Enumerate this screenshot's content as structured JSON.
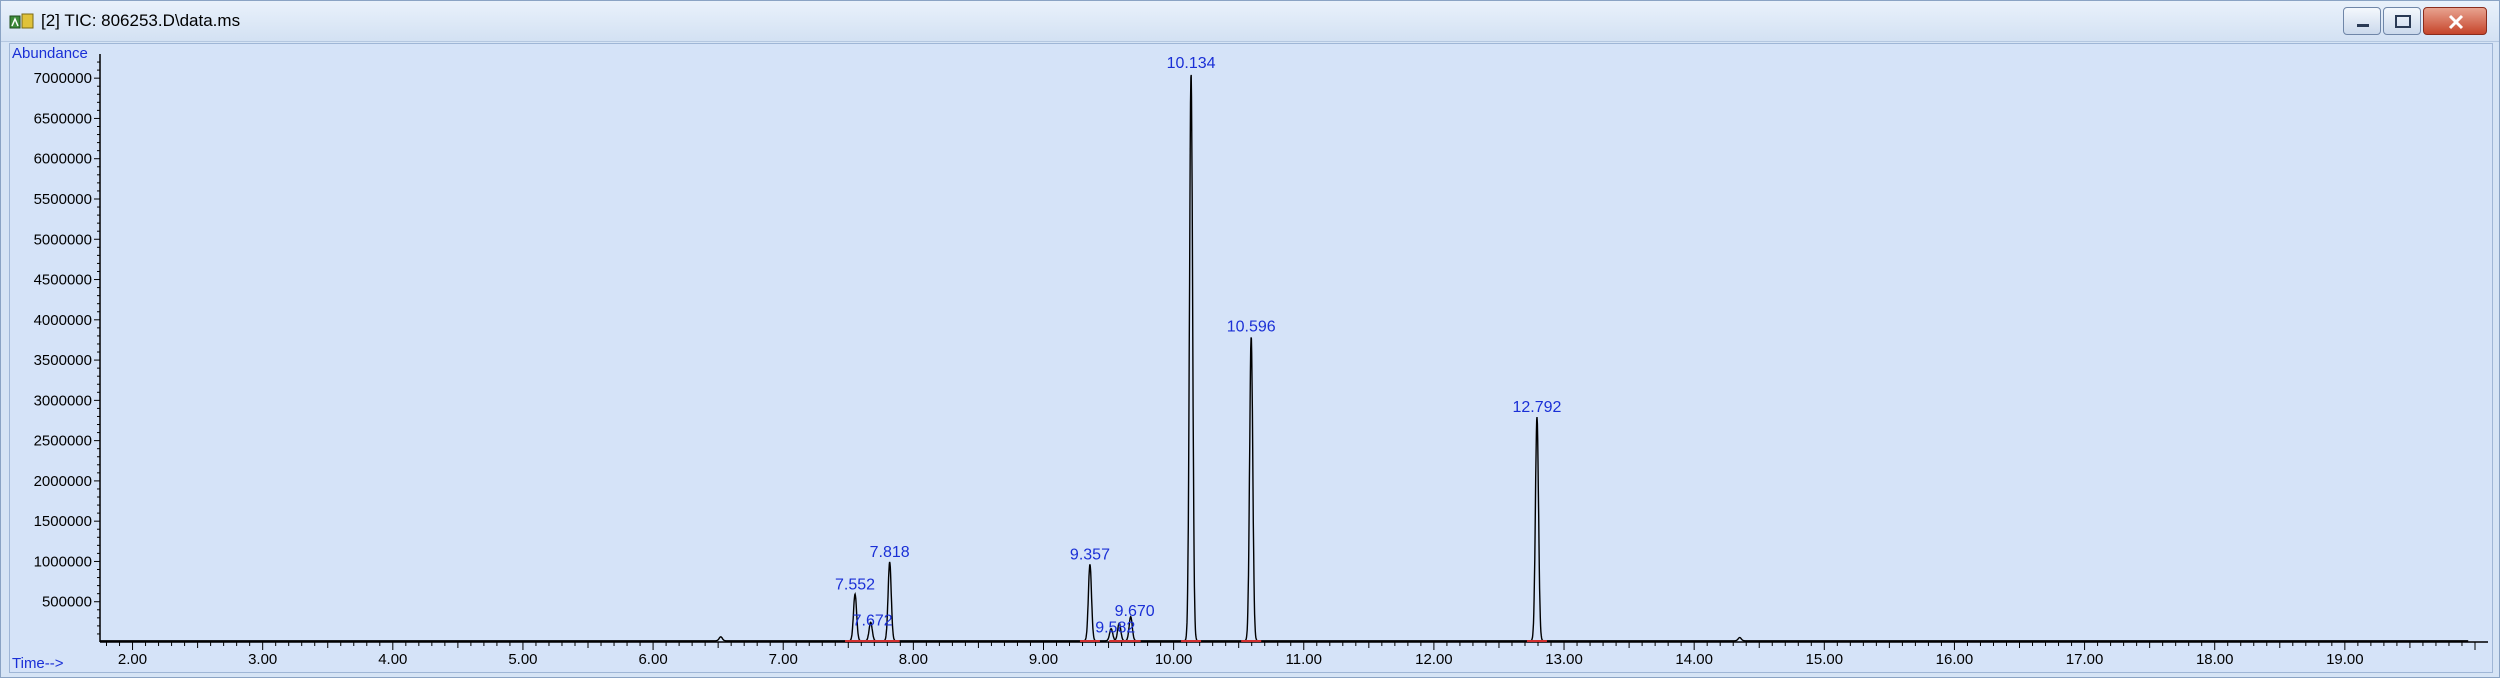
{
  "window": {
    "title": "[2] TIC: 806253.D\\data.ms",
    "icons": {
      "app": "chemstation-app-icon",
      "minimize": "minimize-icon",
      "maximize": "maximize-icon",
      "close": "close-icon"
    }
  },
  "colors": {
    "background": "#d5e3f8",
    "trace": "#000000",
    "labels": "#1a2fd6",
    "baseline_markers": "#d23030"
  },
  "chart_data": {
    "type": "line",
    "title": "",
    "xlabel": "Time-->",
    "ylabel": "Abundance",
    "xlim": [
      1.75,
      20.1
    ],
    "ylim": [
      0,
      7300000
    ],
    "x_ticks": [
      "2.00",
      "3.00",
      "4.00",
      "5.00",
      "6.00",
      "7.00",
      "8.00",
      "9.00",
      "10.00",
      "11.00",
      "12.00",
      "13.00",
      "14.00",
      "15.00",
      "16.00",
      "17.00",
      "18.00",
      "19.00"
    ],
    "y_ticks": [
      "500000",
      "1000000",
      "1500000",
      "2000000",
      "2500000",
      "3000000",
      "3500000",
      "4000000",
      "4500000",
      "5000000",
      "5500000",
      "6000000",
      "6500000",
      "7000000"
    ],
    "baseline": 15000,
    "peaks": [
      {
        "rt": 6.52,
        "height": 50000,
        "label": ""
      },
      {
        "rt": 7.552,
        "height": 580000,
        "label": "7.552"
      },
      {
        "rt": 7.672,
        "height": 230000,
        "label": "7.672"
      },
      {
        "rt": 7.818,
        "height": 980000,
        "label": "7.818"
      },
      {
        "rt": 9.357,
        "height": 950000,
        "label": "9.357"
      },
      {
        "rt": 9.52,
        "height": 150000,
        "label": ""
      },
      {
        "rt": 9.582,
        "height": 220000,
        "label": "9.582"
      },
      {
        "rt": 9.67,
        "height": 300000,
        "label": "9.670"
      },
      {
        "rt": 10.134,
        "height": 7050000,
        "label": "10.134"
      },
      {
        "rt": 10.596,
        "height": 3780000,
        "label": "10.596"
      },
      {
        "rt": 12.792,
        "height": 2780000,
        "label": "12.792"
      },
      {
        "rt": 14.35,
        "height": 40000,
        "label": ""
      }
    ]
  }
}
